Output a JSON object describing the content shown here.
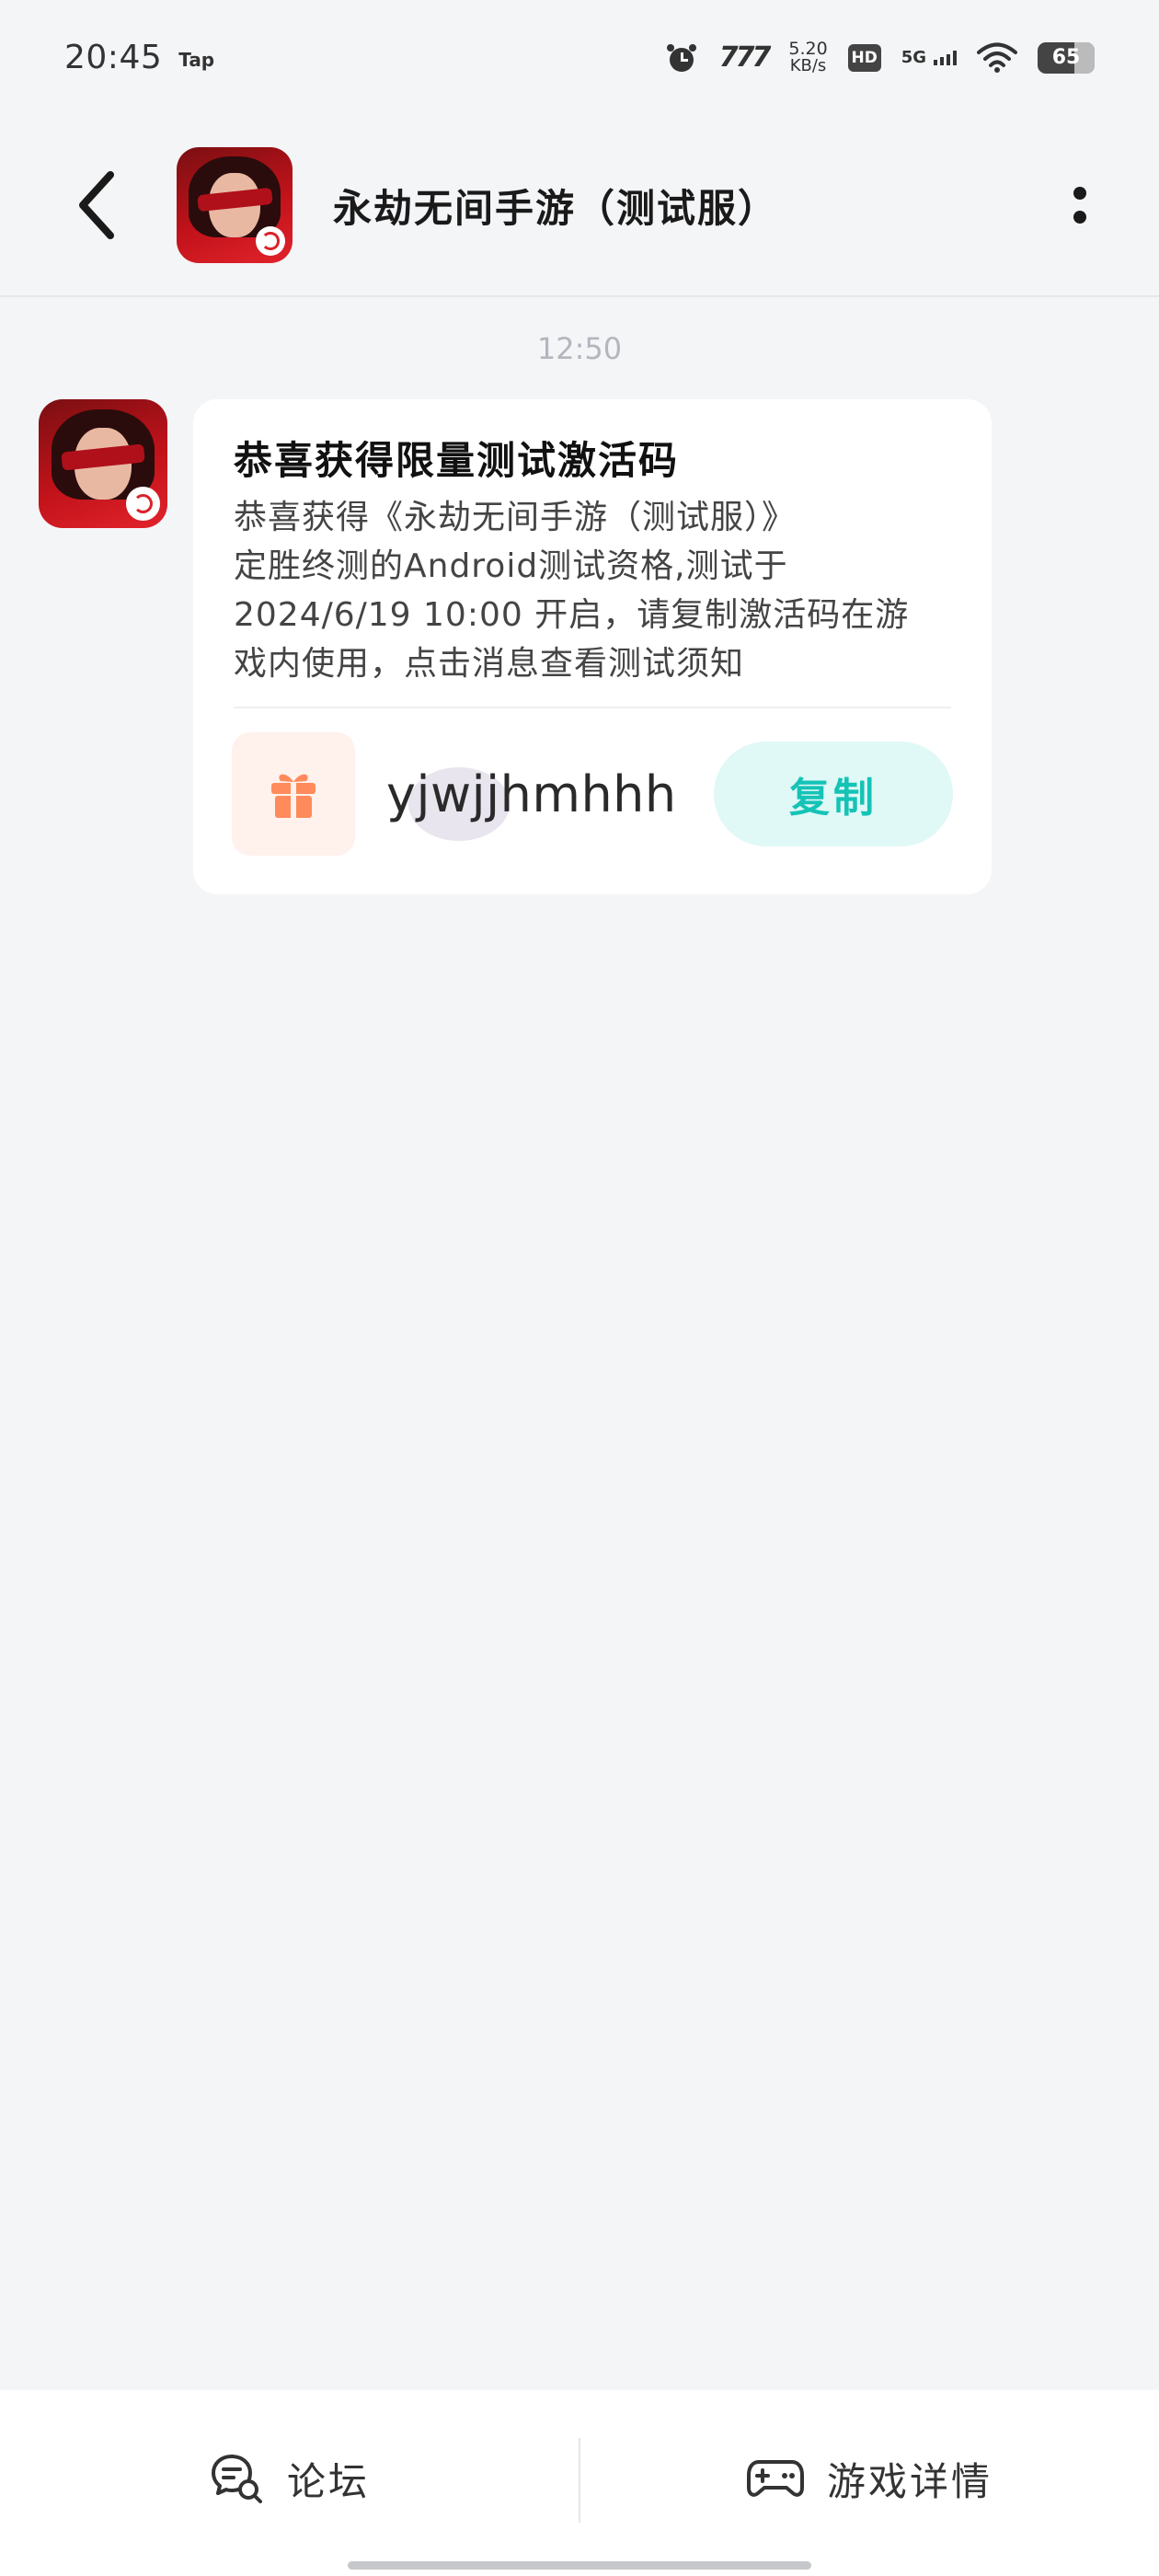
{
  "status_bar": {
    "time": "20:45",
    "tap_label": "Tap",
    "speed_logo": "777",
    "net_speed_value": "5.20",
    "net_speed_unit": "KB/s",
    "hd_label": "HD",
    "network_label": "5G",
    "battery": "65"
  },
  "header": {
    "title": "永劫无间手游（测试服）"
  },
  "chat": {
    "timestamp": "12:50",
    "message": {
      "title": "恭喜获得限量测试激活码",
      "body_lines": [
        "恭喜获得《永劫无间手游（测试服）》",
        "定胜终测的Android测试资格,测试于",
        "2024/6/19 10:00 开启，请复制激活码在游",
        "戏内使用，点击消息查看测试须知"
      ],
      "code": "yjwjjhmhhh",
      "copy_label": "复制"
    }
  },
  "bottom_bar": {
    "forum_label": "论坛",
    "game_detail_label": "游戏详情"
  },
  "colors": {
    "accent": "#15c3b6",
    "gift": "#ff8a5b",
    "background": "#f4f5f7"
  }
}
